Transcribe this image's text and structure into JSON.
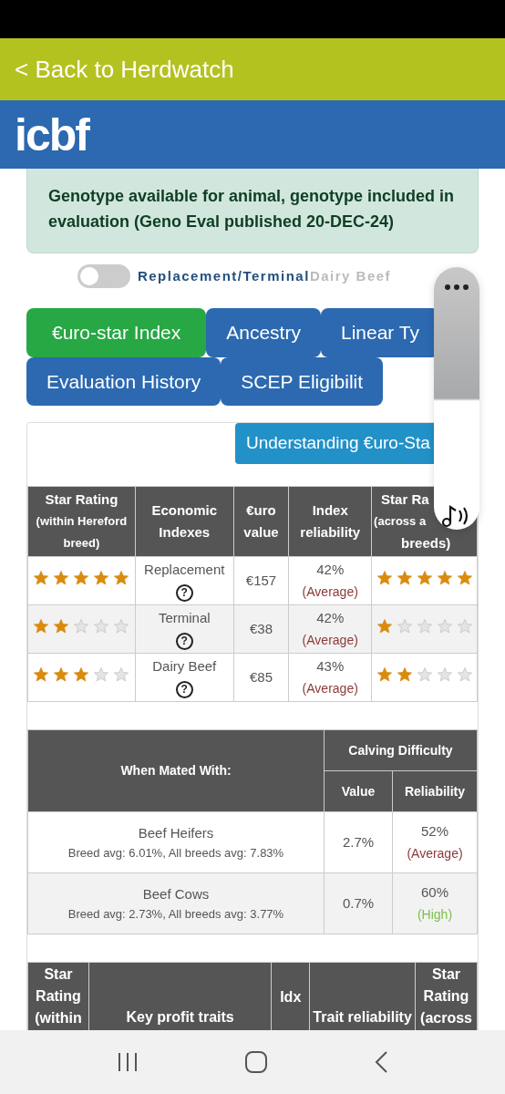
{
  "back_link": "< Back to Herdwatch",
  "logo": "icbf",
  "alert": "Genotype available for animal, genotype included in evaluation (Geno Eval published 20-DEC-24)",
  "toggle": {
    "on": false,
    "labels": [
      {
        "text": "Replacement/Terminal",
        "selected": true
      },
      {
        "text": "Dairy Beef",
        "selected": false
      }
    ]
  },
  "tabs": [
    {
      "label": "€uro-star Index",
      "selected": true
    },
    {
      "label": "Ancestry",
      "selected": false
    },
    {
      "label": "Linear Ty",
      "selected": false
    },
    {
      "label": "Evaluation History",
      "selected": false
    },
    {
      "label": "SCEP Eligibilit",
      "selected": false
    }
  ],
  "understanding_button": "Understanding €uro-Sta",
  "index_table": {
    "columns": [
      [
        "Star Rating",
        "(within Hereford",
        "breed)"
      ],
      [
        "Economic",
        "Indexes"
      ],
      [
        "€uro",
        "value"
      ],
      [
        "Index",
        "reliability"
      ],
      [
        "Star Ra",
        "(across a",
        "breeds)"
      ]
    ],
    "rows": [
      {
        "within": {
          "stars": 5
        },
        "name": "Replacement",
        "help": "?",
        "value": "€157",
        "reliability": "42%",
        "reliability_label": "(Average)",
        "color": "#8b3a3a",
        "across": {
          "stars": 5
        }
      },
      {
        "within": {
          "stars": 2
        },
        "name": "Terminal",
        "help": "?",
        "value": "€38",
        "reliability": "42%",
        "reliability_label": "(Average)",
        "color": "#8b3a3a",
        "across": {
          "stars": 1
        }
      },
      {
        "within": {
          "stars": 3
        },
        "name": "Dairy Beef",
        "help": "?",
        "value": "€85",
        "reliability": "43%",
        "reliability_label": "(Average)",
        "color": "#8b3a3a",
        "across": {
          "stars": 2
        }
      }
    ]
  },
  "calving_table": {
    "mated_header": "When Mated With:",
    "group_header": "Calving Difficulty",
    "value_header": "Value",
    "reliability_header": "Reliability",
    "rows": [
      {
        "name": "Beef Heifers",
        "averages": "Breed avg: 6.01%, All breeds avg: 7.83%",
        "value": "2.7%",
        "reliability": "52%",
        "reliability_label": "(Average)",
        "color": "#8b3a3a"
      },
      {
        "name": "Beef Cows",
        "averages": "Breed avg: 2.73%, All breeds avg: 3.77%",
        "value": "0.7%",
        "reliability": "60%",
        "reliability_label": "(High)",
        "color": "#7cc04a"
      }
    ]
  },
  "traits_table": {
    "columns": [
      [
        "Star",
        "Rating",
        "(within"
      ],
      [
        "Key profit traits"
      ],
      [
        "Idx"
      ],
      [
        "Trait reliability"
      ],
      [
        "Star",
        "Rating",
        "(across"
      ]
    ]
  }
}
